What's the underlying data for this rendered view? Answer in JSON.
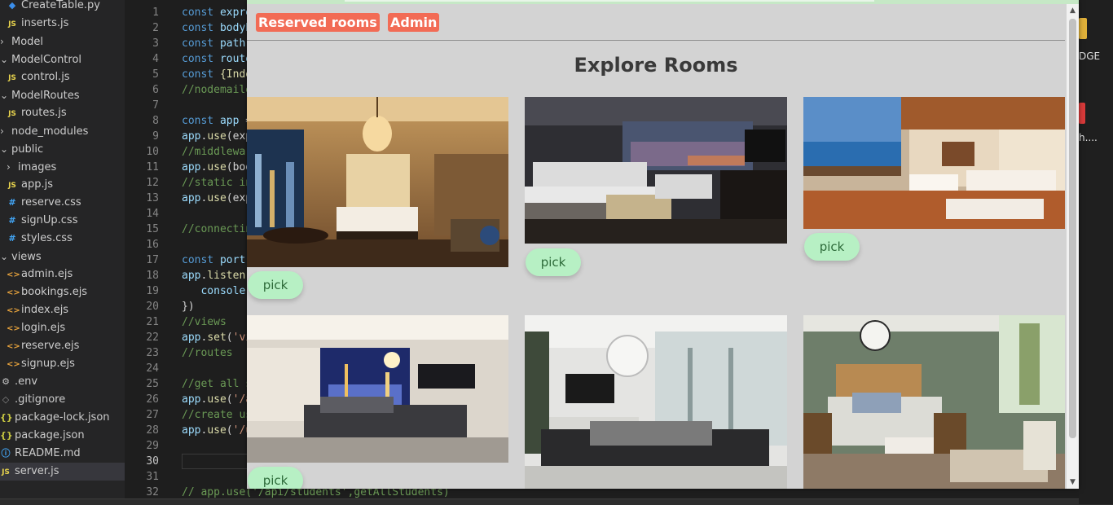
{
  "editor": {
    "explorer": [
      {
        "name": "CreateTable.py",
        "icon": "python-icon",
        "indent": 1
      },
      {
        "name": "inserts.js",
        "icon": "js-file-icon",
        "indent": 1
      },
      {
        "name": "Model",
        "icon": "chevron-right-icon",
        "indent": 0
      },
      {
        "name": "ModelControl",
        "icon": "chevron-down-icon",
        "indent": 0
      },
      {
        "name": "control.js",
        "icon": "js-file-icon",
        "indent": 1
      },
      {
        "name": "ModelRoutes",
        "icon": "chevron-down-icon",
        "indent": 0
      },
      {
        "name": "routes.js",
        "icon": "js-file-icon",
        "indent": 1
      },
      {
        "name": "node_modules",
        "icon": "chevron-right-icon",
        "indent": 0
      },
      {
        "name": "public",
        "icon": "chevron-down-icon",
        "indent": 0
      },
      {
        "name": "images",
        "icon": "chevron-right-icon",
        "indent": 1
      },
      {
        "name": "app.js",
        "icon": "js-file-icon",
        "indent": 1
      },
      {
        "name": "reserve.css",
        "icon": "css-file-icon",
        "indent": 1
      },
      {
        "name": "signUp.css",
        "icon": "css-file-icon",
        "indent": 1
      },
      {
        "name": "styles.css",
        "icon": "css-file-icon",
        "indent": 1
      },
      {
        "name": "views",
        "icon": "chevron-down-icon",
        "indent": 0
      },
      {
        "name": "admin.ejs",
        "icon": "ejs-file-icon",
        "indent": 1
      },
      {
        "name": "bookings.ejs",
        "icon": "ejs-file-icon",
        "indent": 1
      },
      {
        "name": "index.ejs",
        "icon": "ejs-file-icon",
        "indent": 1
      },
      {
        "name": "login.ejs",
        "icon": "ejs-file-icon",
        "indent": 1
      },
      {
        "name": "reserve.ejs",
        "icon": "ejs-file-icon",
        "indent": 1
      },
      {
        "name": "signup.ejs",
        "icon": "ejs-file-icon",
        "indent": 1
      },
      {
        "name": ".env",
        "icon": "gear-icon",
        "indent": 0
      },
      {
        "name": ".gitignore",
        "icon": "git-icon",
        "indent": 0
      },
      {
        "name": "package-lock.json",
        "icon": "json-file-icon",
        "indent": 0
      },
      {
        "name": "package.json",
        "icon": "json-file-icon",
        "indent": 0
      },
      {
        "name": "README.md",
        "icon": "info-icon",
        "indent": 0
      },
      {
        "name": "server.js",
        "icon": "js-file-icon",
        "indent": 0,
        "selected": true
      }
    ],
    "icon_glyphs": {
      "js": "JS",
      "css": "#",
      "ejs": "<>",
      "json": "{}",
      "py": "◆",
      "env": "⚙",
      "git": "◇",
      "info": "ⓘ",
      "chev_r": "›",
      "chev_d": "⌄"
    },
    "line_numbers": [
      "1",
      "2",
      "3",
      "4",
      "5",
      "6",
      "7",
      "8",
      "9",
      "10",
      "11",
      "12",
      "13",
      "14",
      "15",
      "16",
      "17",
      "18",
      "19",
      "20",
      "21",
      "22",
      "23",
      "24",
      "25",
      "26",
      "27",
      "28",
      "29",
      "30",
      "31",
      "32"
    ],
    "active_line": "30",
    "code_lines": [
      [
        [
          "kw",
          "const "
        ],
        [
          "vr",
          "expre"
        ]
      ],
      [
        [
          "kw",
          "const "
        ],
        [
          "vr",
          "bodyP"
        ]
      ],
      [
        [
          "kw",
          "const "
        ],
        [
          "vr",
          "path "
        ]
      ],
      [
        [
          "kw",
          "const "
        ],
        [
          "vr",
          "route"
        ]
      ],
      [
        [
          "kw",
          "const "
        ],
        [
          "fn",
          "{Inde"
        ]
      ],
      [
        [
          "cm",
          "//nodemaile"
        ]
      ],
      [],
      [
        [
          "kw",
          "const "
        ],
        [
          "vr",
          "app "
        ],
        [
          "tx",
          "="
        ]
      ],
      [
        [
          "vr",
          "app"
        ],
        [
          "tx",
          "."
        ],
        [
          "fn",
          "use"
        ],
        [
          "tx",
          "(exp"
        ]
      ],
      [
        [
          "cm",
          "//middlewar"
        ]
      ],
      [
        [
          "vr",
          "app"
        ],
        [
          "tx",
          "."
        ],
        [
          "fn",
          "use"
        ],
        [
          "tx",
          "(boo"
        ]
      ],
      [
        [
          "cm",
          "//static in"
        ]
      ],
      [
        [
          "vr",
          "app"
        ],
        [
          "tx",
          "."
        ],
        [
          "fn",
          "use"
        ],
        [
          "tx",
          "(exp"
        ]
      ],
      [],
      [
        [
          "cm",
          "//connectin"
        ]
      ],
      [],
      [
        [
          "kw",
          "const "
        ],
        [
          "vr",
          "port"
        ]
      ],
      [
        [
          "vr",
          "app"
        ],
        [
          "tx",
          "."
        ],
        [
          "fn",
          "listen"
        ],
        [
          "tx",
          "("
        ]
      ],
      [
        [
          "tx",
          "   "
        ],
        [
          "vr",
          "console"
        ]
      ],
      [
        [
          "tx",
          "})"
        ]
      ],
      [
        [
          "cm",
          "//views"
        ]
      ],
      [
        [
          "vr",
          "app"
        ],
        [
          "tx",
          "."
        ],
        [
          "fn",
          "set"
        ],
        [
          "tx",
          "("
        ],
        [
          "st",
          "'vi"
        ]
      ],
      [
        [
          "cm",
          "//routes"
        ]
      ],
      [],
      [
        [
          "cm",
          "//get all s"
        ]
      ],
      [
        [
          "vr",
          "app"
        ],
        [
          "tx",
          "."
        ],
        [
          "fn",
          "use"
        ],
        [
          "tx",
          "("
        ],
        [
          "st",
          "'/a"
        ]
      ],
      [
        [
          "cm",
          "//create us"
        ]
      ],
      [
        [
          "vr",
          "app"
        ],
        [
          "tx",
          "."
        ],
        [
          "fn",
          "use"
        ],
        [
          "tx",
          "("
        ],
        [
          "st",
          "'/u"
        ]
      ],
      [],
      [],
      [],
      [
        [
          "cm",
          "// app.use('/api/students',getAllStudents)"
        ]
      ]
    ]
  },
  "right_strip": {
    "text1": "DGE",
    "text2": "h...."
  },
  "browser": {
    "nav": {
      "reserved_label": "Reserved rooms",
      "admin_label": "Admin"
    },
    "title": "Explore Rooms",
    "rooms": [
      {
        "theme": "warm-hotel-city-view",
        "button": "pick"
      },
      {
        "theme": "modern-grey-suite",
        "button": "pick"
      },
      {
        "theme": "wood-ceiling-ocean-view",
        "button": "pick"
      },
      {
        "theme": "night-city-penthouse",
        "button": "pick"
      },
      {
        "theme": "white-palm-room",
        "button": "pick"
      },
      {
        "theme": "green-wall-bedroom",
        "button": "pick"
      }
    ]
  }
}
